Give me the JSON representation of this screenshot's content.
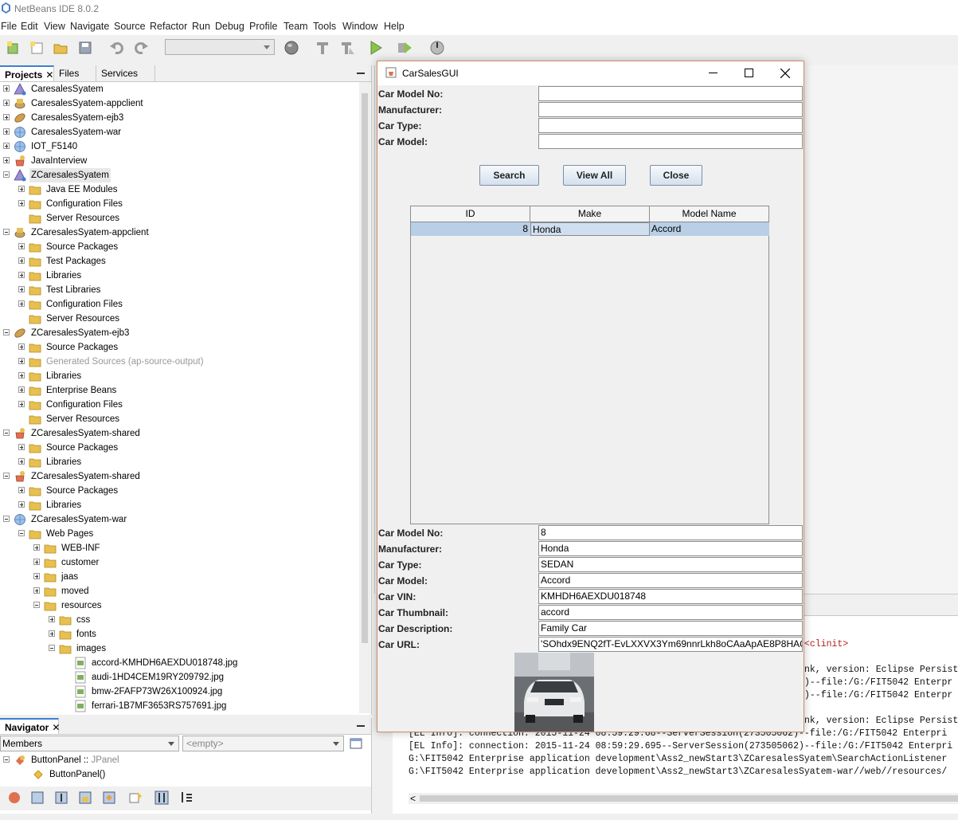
{
  "window": {
    "title": "NetBeans IDE 8.0.2"
  },
  "menu": [
    "File",
    "Edit",
    "View",
    "Navigate",
    "Source",
    "Refactor",
    "Run",
    "Debug",
    "Profile",
    "Team",
    "Tools",
    "Window",
    "Help"
  ],
  "toolbar_icons": [
    "new-project-icon",
    "new-file-icon",
    "open-project-icon",
    "save-all-icon",
    "undo-icon",
    "redo-icon",
    "config-combo",
    "globe-icon",
    "build-icon",
    "clean-build-icon",
    "run-icon",
    "debug-icon",
    "profile-icon"
  ],
  "projects": {
    "tabs": [
      "Projects",
      "Files",
      "Services"
    ],
    "tree": [
      {
        "label": "CaresalesSyatem",
        "level": 0,
        "exp": "plus",
        "icon": "ear"
      },
      {
        "label": "CaresalesSyatem-appclient",
        "level": 0,
        "exp": "plus",
        "icon": "client"
      },
      {
        "label": "CaresalesSyatem-ejb3",
        "level": 0,
        "exp": "plus",
        "icon": "ejb"
      },
      {
        "label": "CaresalesSyatem-war",
        "level": 0,
        "exp": "plus",
        "icon": "web"
      },
      {
        "label": "IOT_F5140",
        "level": 0,
        "exp": "plus",
        "icon": "web"
      },
      {
        "label": "JavaInterview",
        "level": 0,
        "exp": "plus",
        "icon": "java"
      },
      {
        "label": "ZCaresalesSyatem",
        "level": 0,
        "exp": "minus",
        "icon": "ear",
        "sel": true
      },
      {
        "label": "Java EE Modules",
        "level": 1,
        "exp": "plus",
        "icon": "folder"
      },
      {
        "label": "Configuration Files",
        "level": 1,
        "exp": "plus",
        "icon": "folder"
      },
      {
        "label": "Server Resources",
        "level": 1,
        "exp": "none",
        "icon": "folder"
      },
      {
        "label": "ZCaresalesSyatem-appclient",
        "level": 0,
        "exp": "minus",
        "icon": "client"
      },
      {
        "label": "Source Packages",
        "level": 1,
        "exp": "plus",
        "icon": "folder"
      },
      {
        "label": "Test Packages",
        "level": 1,
        "exp": "plus",
        "icon": "folder"
      },
      {
        "label": "Libraries",
        "level": 1,
        "exp": "plus",
        "icon": "folder"
      },
      {
        "label": "Test Libraries",
        "level": 1,
        "exp": "plus",
        "icon": "folder"
      },
      {
        "label": "Configuration Files",
        "level": 1,
        "exp": "plus",
        "icon": "folder"
      },
      {
        "label": "Server Resources",
        "level": 1,
        "exp": "none",
        "icon": "folder"
      },
      {
        "label": "ZCaresalesSyatem-ejb3",
        "level": 0,
        "exp": "minus",
        "icon": "ejb"
      },
      {
        "label": "Source Packages",
        "level": 1,
        "exp": "plus",
        "icon": "folder"
      },
      {
        "label": "Generated Sources (ap-source-output)",
        "level": 1,
        "exp": "plus",
        "icon": "folder",
        "dim": true
      },
      {
        "label": "Libraries",
        "level": 1,
        "exp": "plus",
        "icon": "folder"
      },
      {
        "label": "Enterprise Beans",
        "level": 1,
        "exp": "plus",
        "icon": "folder"
      },
      {
        "label": "Configuration Files",
        "level": 1,
        "exp": "plus",
        "icon": "folder"
      },
      {
        "label": "Server Resources",
        "level": 1,
        "exp": "none",
        "icon": "folder"
      },
      {
        "label": "ZCaresalesSyatem-shared",
        "level": 0,
        "exp": "minus",
        "icon": "java"
      },
      {
        "label": "Source Packages",
        "level": 1,
        "exp": "plus",
        "icon": "folder"
      },
      {
        "label": "Libraries",
        "level": 1,
        "exp": "plus",
        "icon": "folder"
      },
      {
        "label": "ZCaresalesSyatem-shared",
        "level": 0,
        "exp": "minus",
        "icon": "java"
      },
      {
        "label": "Source Packages",
        "level": 1,
        "exp": "plus",
        "icon": "folder"
      },
      {
        "label": "Libraries",
        "level": 1,
        "exp": "plus",
        "icon": "folder"
      },
      {
        "label": "ZCaresalesSyatem-war",
        "level": 0,
        "exp": "minus",
        "icon": "web"
      },
      {
        "label": "Web Pages",
        "level": 1,
        "exp": "minus",
        "icon": "folder"
      },
      {
        "label": "WEB-INF",
        "level": 2,
        "exp": "plus",
        "icon": "folder"
      },
      {
        "label": "customer",
        "level": 2,
        "exp": "plus",
        "icon": "folder"
      },
      {
        "label": "jaas",
        "level": 2,
        "exp": "plus",
        "icon": "folder"
      },
      {
        "label": "moved",
        "level": 2,
        "exp": "plus",
        "icon": "folder"
      },
      {
        "label": "resources",
        "level": 2,
        "exp": "minus",
        "icon": "folder"
      },
      {
        "label": "css",
        "level": 3,
        "exp": "plus",
        "icon": "folder"
      },
      {
        "label": "fonts",
        "level": 3,
        "exp": "plus",
        "icon": "folder"
      },
      {
        "label": "images",
        "level": 3,
        "exp": "minus",
        "icon": "folder"
      },
      {
        "label": "accord-KMHDH6AEXDU018748.jpg",
        "level": 4,
        "exp": "none",
        "icon": "image"
      },
      {
        "label": "audi-1HD4CEM19RY209792.jpg",
        "level": 4,
        "exp": "none",
        "icon": "image"
      },
      {
        "label": "bmw-2FAFP73W26X100924.jpg",
        "level": 4,
        "exp": "none",
        "icon": "image"
      },
      {
        "label": "ferrari-1B7MF3653RS757691.jpg",
        "level": 4,
        "exp": "none",
        "icon": "image"
      }
    ]
  },
  "navigator": {
    "tab": "Navigator",
    "filter": "Members",
    "context": "<empty>",
    "items": [
      {
        "label": "ButtonPanel :: ",
        "type": "JPanel"
      },
      {
        "label": "ButtonPanel()"
      }
    ]
  },
  "output": {
    "lines": [
      {
        "text": "<clinit>",
        "red": true
      },
      {
        "text": "nk, version: Eclipse Persist"
      },
      {
        "text": ")--file:/G:/FIT5042 Enterpr"
      },
      {
        "text": ")--file:/G:/FIT5042 Enterpr"
      },
      {
        "text": "nk, version: Eclipse Persist"
      },
      {
        "text": "[EL Info]: connection: 2015-11-24 08:59:29.68--ServerSession(273505062)--file:/G:/FIT5042 Enterpri"
      },
      {
        "text": "[EL Info]: connection: 2015-11-24 08:59:29.695--ServerSession(273505062)--file:/G:/FIT5042 Enterpri"
      },
      {
        "text": "G:\\FIT5042 Enterprise application development\\Ass2_newStart3\\ZCaresalesSyatem\\SearchActionListener"
      },
      {
        "text": "G:\\FIT5042 Enterprise application development\\Ass2_newStart3\\ZCaresalesSyatem-war//web//resources/"
      }
    ]
  },
  "dialog": {
    "title": "CarSalesGUI",
    "search_fields": [
      {
        "label": "Car Model No:",
        "value": ""
      },
      {
        "label": "Manufacturer:",
        "value": ""
      },
      {
        "label": "Car Type:",
        "value": ""
      },
      {
        "label": "Car Model:",
        "value": ""
      }
    ],
    "buttons": {
      "search": "Search",
      "view_all": "View All",
      "close": "Close"
    },
    "table": {
      "columns": [
        "ID",
        "Make",
        "Model Name"
      ],
      "rows": [
        {
          "id": "8",
          "make": "Honda",
          "model": "Accord"
        }
      ]
    },
    "detail_fields": [
      {
        "label": "Car Model No:",
        "value": "8"
      },
      {
        "label": "Manufacturer:",
        "value": "Honda"
      },
      {
        "label": "Car Type:",
        "value": "SEDAN"
      },
      {
        "label": "Car Model:",
        "value": "Accord"
      },
      {
        "label": "Car VIN:",
        "value": "KMHDH6AEXDU018748"
      },
      {
        "label": "Car Thumbnail:",
        "value": "accord"
      },
      {
        "label": "Car Description:",
        "value": "Family Car"
      },
      {
        "label": "Car URL:",
        "value": "'SOhdx9ENQ2fT-EvLXXVX3Ym69nnrLkh8oCAaApAE8P8HAQ"
      }
    ],
    "thumbnail_alt": "car-thumbnail-image"
  },
  "colors": {
    "selection": "#b8cfe5",
    "accent": "#3f7fd0",
    "folder": "#e8c050"
  }
}
